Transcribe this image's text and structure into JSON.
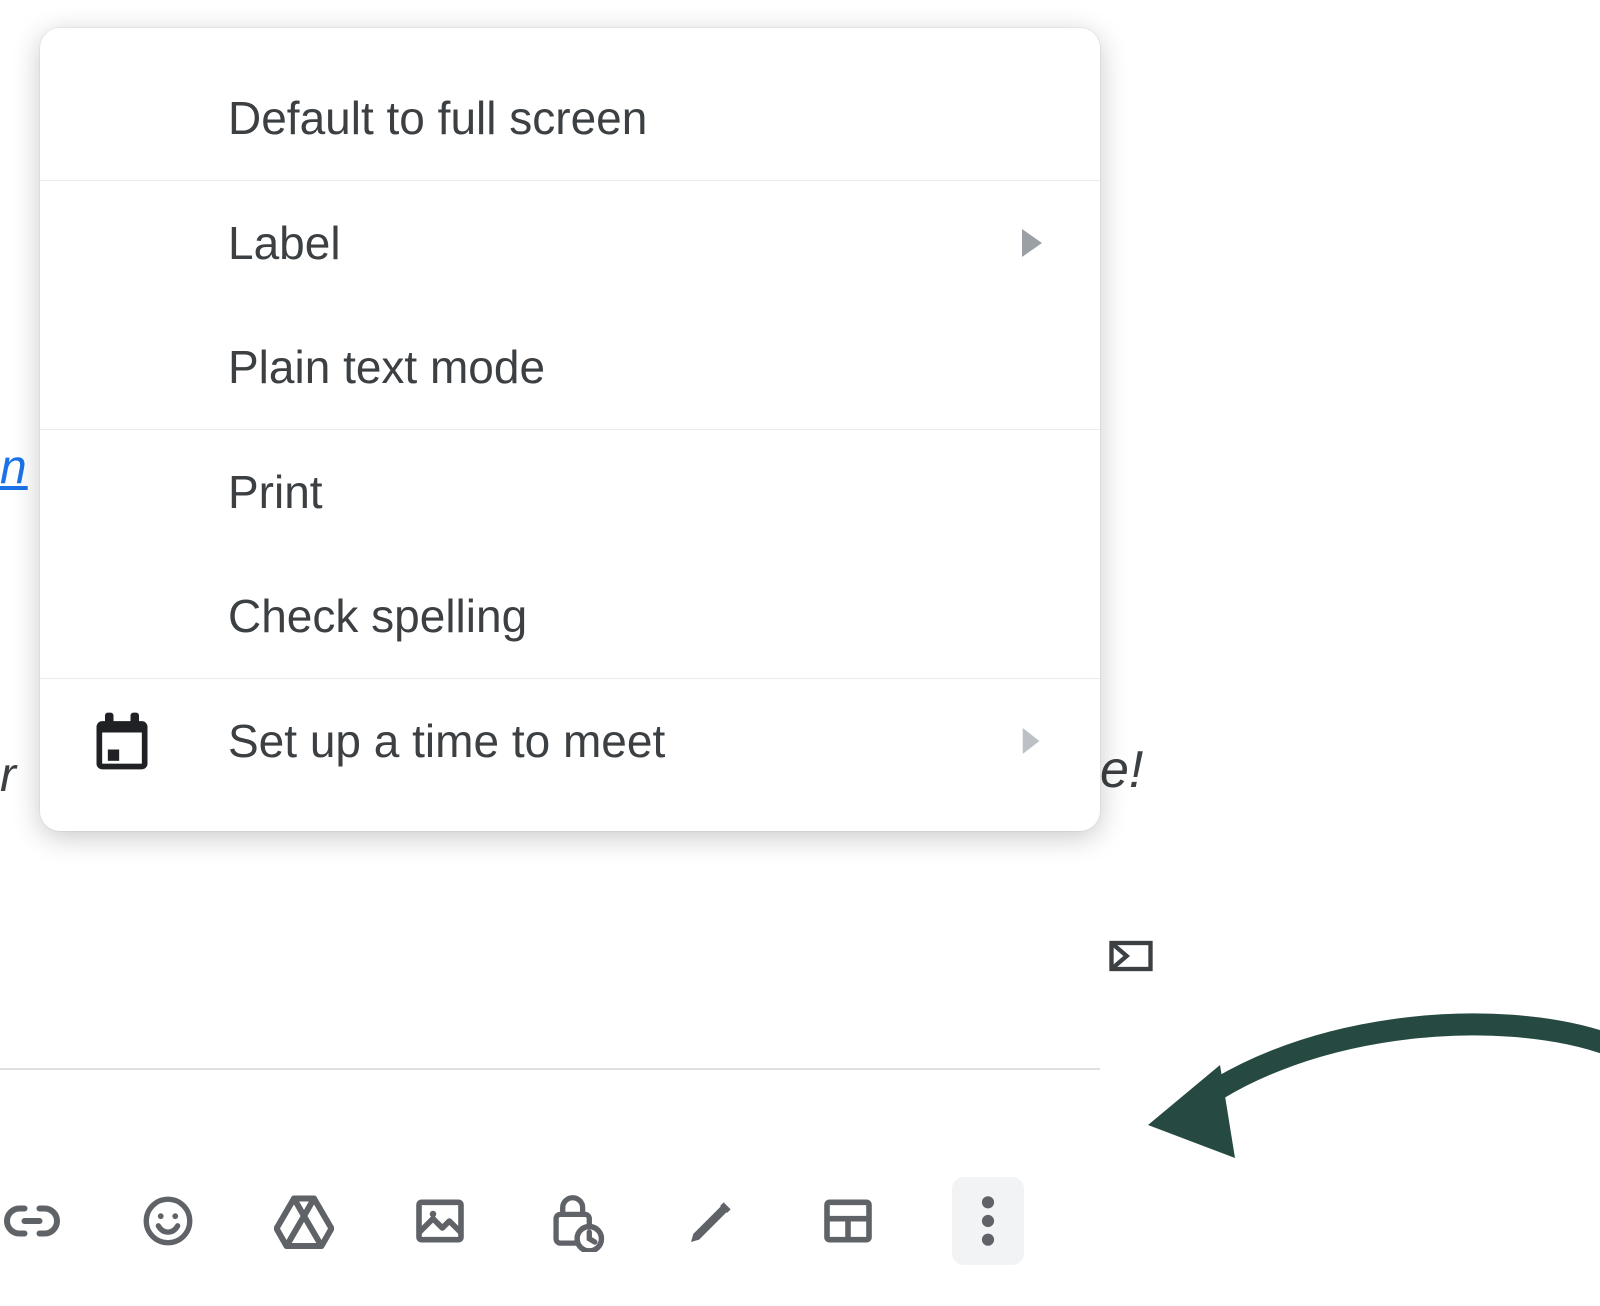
{
  "menu": {
    "items": [
      {
        "label": "Default to full screen",
        "has_submenu": false,
        "icon": null
      },
      {
        "label": "Label",
        "has_submenu": true,
        "icon": null
      },
      {
        "label": "Plain text mode",
        "has_submenu": false,
        "icon": null
      },
      {
        "label": "Print",
        "has_submenu": false,
        "icon": null
      },
      {
        "label": "Check spelling",
        "has_submenu": false,
        "icon": null
      },
      {
        "label": "Set up a time to meet",
        "has_submenu": true,
        "icon": "calendar"
      }
    ]
  },
  "toolbar": {
    "items": [
      {
        "name": "insert-link",
        "icon": "link"
      },
      {
        "name": "insert-emoji",
        "icon": "emoji"
      },
      {
        "name": "insert-drive-file",
        "icon": "drive"
      },
      {
        "name": "insert-photo",
        "icon": "image"
      },
      {
        "name": "confidential-mode",
        "icon": "lock-clock"
      },
      {
        "name": "insert-signature",
        "icon": "pen"
      },
      {
        "name": "select-layout",
        "icon": "layout"
      },
      {
        "name": "more-options",
        "icon": "more-vert"
      }
    ]
  },
  "background": {
    "link_fragment": "n",
    "italic_r": "r",
    "italic_e": "e!"
  },
  "annotation": {
    "arrow_color": "#264a42"
  }
}
